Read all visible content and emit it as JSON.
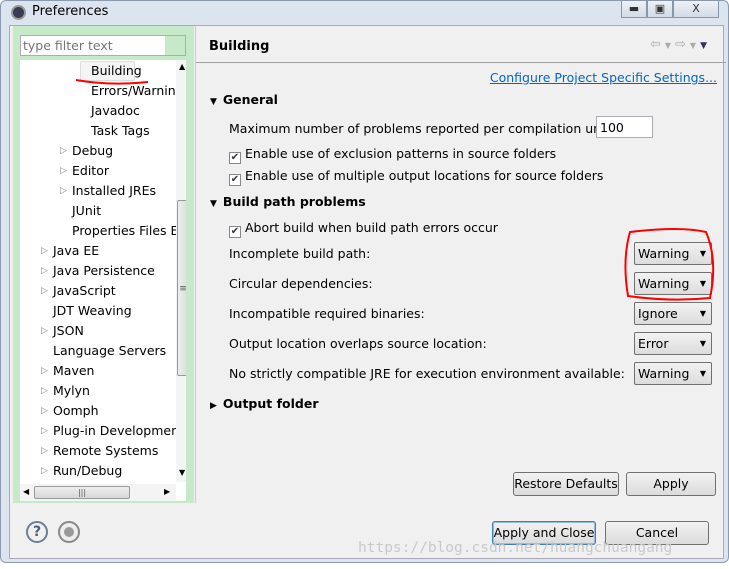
{
  "window": {
    "title": "Preferences",
    "controls": [
      "minimize",
      "maximize",
      "close"
    ]
  },
  "filter": {
    "placeholder": "type filter text"
  },
  "tree": {
    "items": [
      {
        "label": "Building",
        "level": 3,
        "expandable": false,
        "selected": true
      },
      {
        "label": "Errors/Warnings",
        "level": 3,
        "expandable": false
      },
      {
        "label": "Javadoc",
        "level": 3,
        "expandable": false
      },
      {
        "label": "Task Tags",
        "level": 3,
        "expandable": false
      },
      {
        "label": "Debug",
        "level": 2,
        "expandable": true
      },
      {
        "label": "Editor",
        "level": 2,
        "expandable": true
      },
      {
        "label": "Installed JREs",
        "level": 2,
        "expandable": true
      },
      {
        "label": "JUnit",
        "level": 2,
        "expandable": false
      },
      {
        "label": "Properties Files Editor",
        "level": 2,
        "expandable": false
      },
      {
        "label": "Java EE",
        "level": 1,
        "expandable": true
      },
      {
        "label": "Java Persistence",
        "level": 1,
        "expandable": true
      },
      {
        "label": "JavaScript",
        "level": 1,
        "expandable": true
      },
      {
        "label": "JDT Weaving",
        "level": 1,
        "expandable": false
      },
      {
        "label": "JSON",
        "level": 1,
        "expandable": true
      },
      {
        "label": "Language Servers",
        "level": 1,
        "expandable": false
      },
      {
        "label": "Maven",
        "level": 1,
        "expandable": true
      },
      {
        "label": "Mylyn",
        "level": 1,
        "expandable": true
      },
      {
        "label": "Oomph",
        "level": 1,
        "expandable": true
      },
      {
        "label": "Plug-in Development",
        "level": 1,
        "expandable": true
      },
      {
        "label": "Remote Systems",
        "level": 1,
        "expandable": true
      },
      {
        "label": "Run/Debug",
        "level": 1,
        "expandable": true
      }
    ]
  },
  "page": {
    "title": "Building",
    "link": "Configure Project Specific Settings...",
    "general": {
      "title": "General",
      "max_problems_label": "Maximum number of problems reported per compilation unit:",
      "max_problems_value": "100",
      "exclusion_label": "Enable use of exclusion patterns in source folders",
      "exclusion_checked": true,
      "multiple_output_label": "Enable use of multiple output locations for source folders",
      "multiple_output_checked": true
    },
    "build_path": {
      "title": "Build path problems",
      "abort_label": "Abort build when build path errors occur",
      "abort_checked": true,
      "rows": [
        {
          "label": "Incomplete build path:",
          "value": "Warning"
        },
        {
          "label": "Circular dependencies:",
          "value": "Warning"
        },
        {
          "label": "Incompatible required binaries:",
          "value": "Ignore"
        },
        {
          "label": "Output location overlaps source location:",
          "value": "Error"
        },
        {
          "label": "No strictly compatible JRE for execution environment available:",
          "value": "Warning"
        }
      ]
    },
    "output_folder": {
      "title": "Output folder"
    },
    "restore_defaults": "Restore Defaults",
    "apply": "Apply"
  },
  "footer": {
    "apply_close": "Apply and Close",
    "cancel": "Cancel",
    "help_icon": "?"
  },
  "watermark": "https://blog.csdn.net/huangchuangang",
  "colors": {
    "annotation": "#ff0000",
    "link": "#0066cc",
    "tree_panel": "#c6e9c9"
  }
}
